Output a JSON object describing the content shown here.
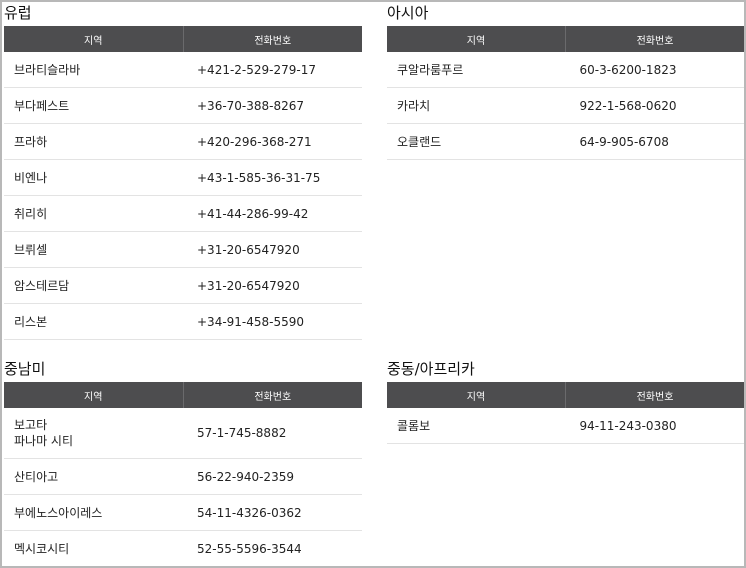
{
  "columns": {
    "region": "지역",
    "phone": "전화번호"
  },
  "europe": {
    "title": "유럽",
    "rows": [
      {
        "region": "브라티슬라바",
        "phone": "+421-2-529-279-17"
      },
      {
        "region": "부다페스트",
        "phone": "+36-70-388-8267"
      },
      {
        "region": "프라하",
        "phone": "+420-296-368-271"
      },
      {
        "region": "비엔나",
        "phone": "+43-1-585-36-31-75"
      },
      {
        "region": "취리히",
        "phone": "+41-44-286-99-42"
      },
      {
        "region": "브뤼셀",
        "phone": "+31-20-6547920"
      },
      {
        "region": "암스테르담",
        "phone": "+31-20-6547920"
      },
      {
        "region": "리스본",
        "phone": "+34-91-458-5590"
      }
    ]
  },
  "asia": {
    "title": "아시아",
    "rows": [
      {
        "region": "쿠알라룸푸르",
        "phone": "60-3-6200-1823"
      },
      {
        "region": "카라치",
        "phone": "922-1-568-0620"
      },
      {
        "region": "오클랜드",
        "phone": "64-9-905-6708"
      }
    ]
  },
  "latam": {
    "title": "중남미",
    "rows": [
      {
        "region": "보고타\n파나마 시티",
        "phone": "57-1-745-8882"
      },
      {
        "region": "산티아고",
        "phone": "56-22-940-2359"
      },
      {
        "region": "부에노스아이레스",
        "phone": "54-11-4326-0362"
      },
      {
        "region": "멕시코시티",
        "phone": "52-55-5596-3544"
      }
    ]
  },
  "mea": {
    "title": "중동/아프리카",
    "rows": [
      {
        "region": "콜롬보",
        "phone": "94-11-243-0380"
      }
    ]
  }
}
